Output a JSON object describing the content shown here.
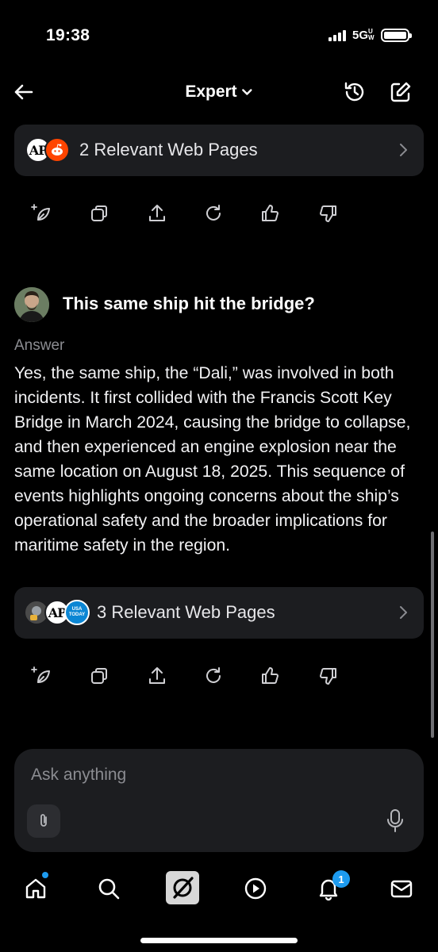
{
  "status": {
    "time": "19:38",
    "network": "5G",
    "network_suffix": "UW"
  },
  "header": {
    "model_label": "Expert"
  },
  "first_sources": {
    "label": "2 Relevant Web Pages"
  },
  "question": {
    "text": "This same ship hit the bridge?"
  },
  "answer": {
    "label": "Answer",
    "text": "Yes, the same ship, the “Dali,” was involved in both incidents. It first collided with the Francis Scott Key Bridge in March 2024, causing the bridge to collapse, and then experienced an engine explosion near the same location on August 18, 2025. This sequence of events highlights ongoing concerns about the ship’s operational safety and the broader implications for maritime safety in the region."
  },
  "second_sources": {
    "label": "3 Relevant Web Pages",
    "usa_text": "USA TODAY"
  },
  "favicons": {
    "ap": "AP"
  },
  "input": {
    "placeholder": "Ask anything"
  },
  "nav": {
    "notification_count": "1"
  },
  "colors": {
    "background": "#000000",
    "card": "#1c1d20",
    "accent": "#1d9bf0",
    "muted": "#8b8c91"
  }
}
